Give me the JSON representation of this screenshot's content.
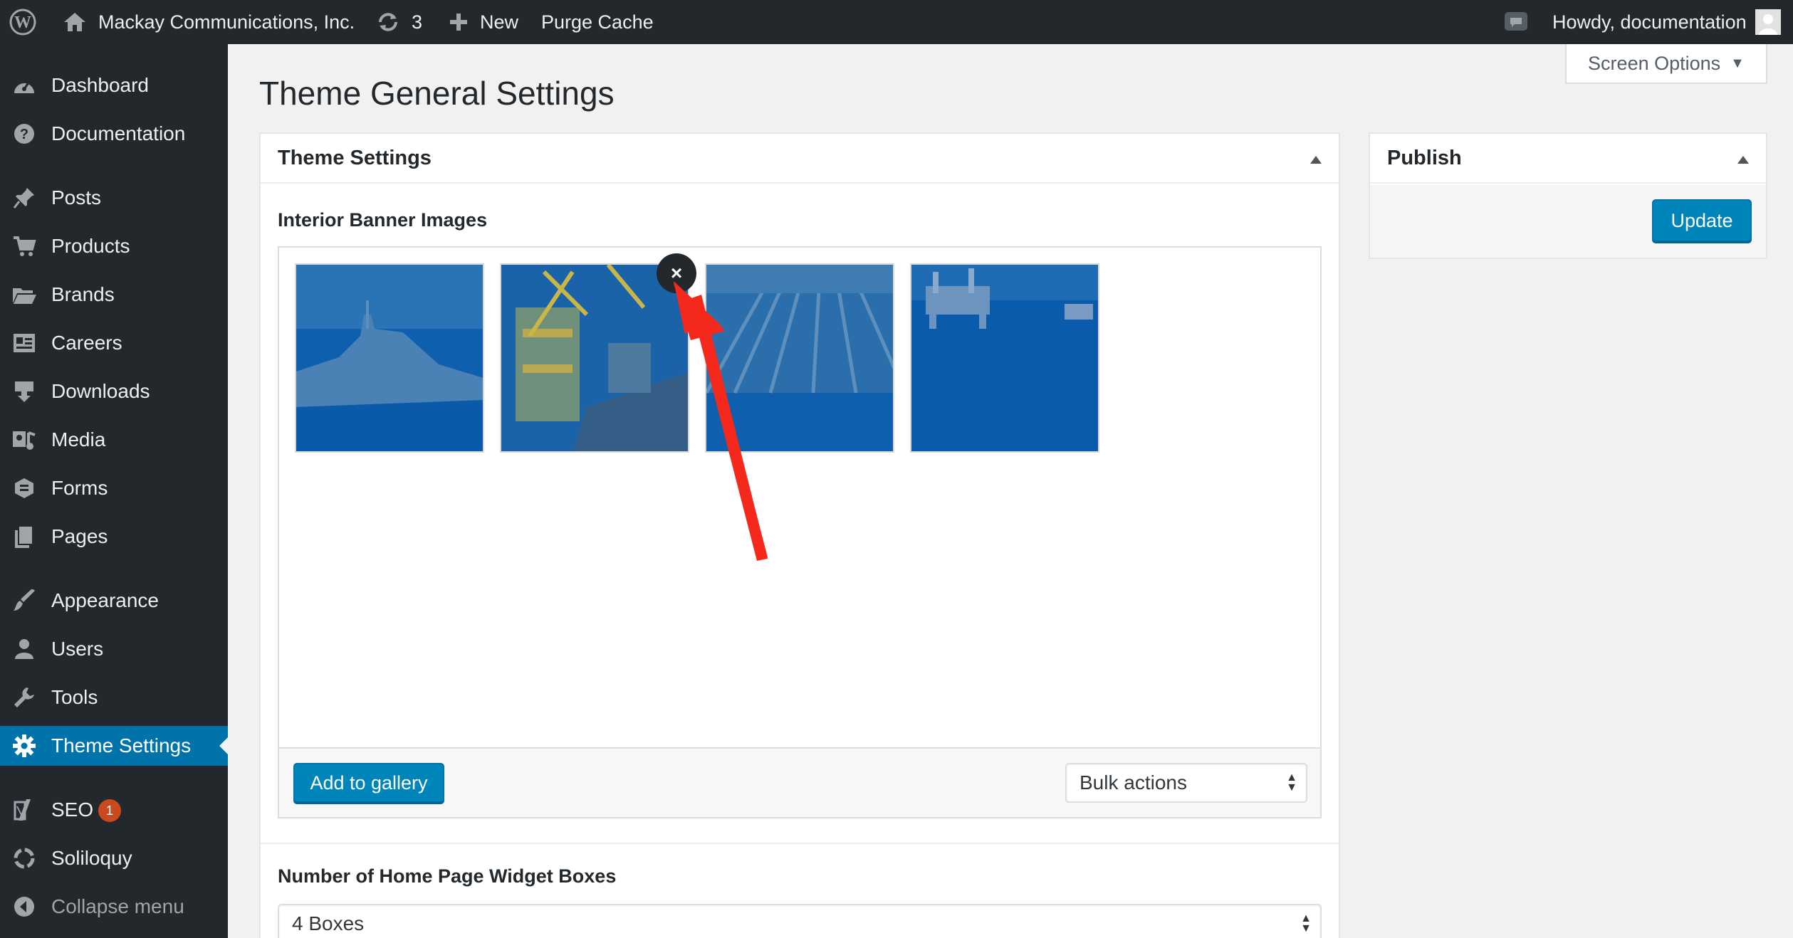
{
  "adminbar": {
    "site_name": "Mackay Communications, Inc.",
    "updates_count": "3",
    "new_label": "New",
    "purge_label": "Purge Cache",
    "howdy": "Howdy, documentation"
  },
  "sidebar": {
    "items": [
      {
        "label": "Dashboard",
        "icon": "dashboard-icon"
      },
      {
        "label": "Documentation",
        "icon": "question-icon"
      },
      {
        "label": "Posts",
        "icon": "pin-icon"
      },
      {
        "label": "Products",
        "icon": "cart-icon"
      },
      {
        "label": "Brands",
        "icon": "folder-icon"
      },
      {
        "label": "Careers",
        "icon": "id-card-icon"
      },
      {
        "label": "Downloads",
        "icon": "download-icon"
      },
      {
        "label": "Media",
        "icon": "media-icon"
      },
      {
        "label": "Forms",
        "icon": "forms-icon"
      },
      {
        "label": "Pages",
        "icon": "pages-icon"
      },
      {
        "label": "Appearance",
        "icon": "brush-icon"
      },
      {
        "label": "Users",
        "icon": "user-icon"
      },
      {
        "label": "Tools",
        "icon": "wrench-icon"
      },
      {
        "label": "Theme Settings",
        "icon": "gear-icon"
      },
      {
        "label": "SEO",
        "icon": "yoast-icon",
        "badge": "1"
      },
      {
        "label": "Soliloquy",
        "icon": "soliloquy-icon"
      },
      {
        "label": "Collapse menu",
        "icon": "collapse-icon"
      }
    ]
  },
  "screen_options": {
    "label": "Screen Options"
  },
  "page": {
    "title": "Theme General Settings"
  },
  "settings_box": {
    "title": "Theme Settings",
    "gallery_label": "Interior Banner Images",
    "add_gallery": "Add to gallery",
    "bulk_actions": "Bulk actions",
    "remove_symbol": "×",
    "widget_label": "Number of Home Page Widget Boxes",
    "widget_value": "4 Boxes"
  },
  "publish": {
    "title": "Publish",
    "update": "Update"
  },
  "colors": {
    "accent": "#0073aa",
    "button": "#0085ba",
    "sidebar": "#23282d",
    "annotation": "#f4291c",
    "badge": "#ca4a1f"
  }
}
